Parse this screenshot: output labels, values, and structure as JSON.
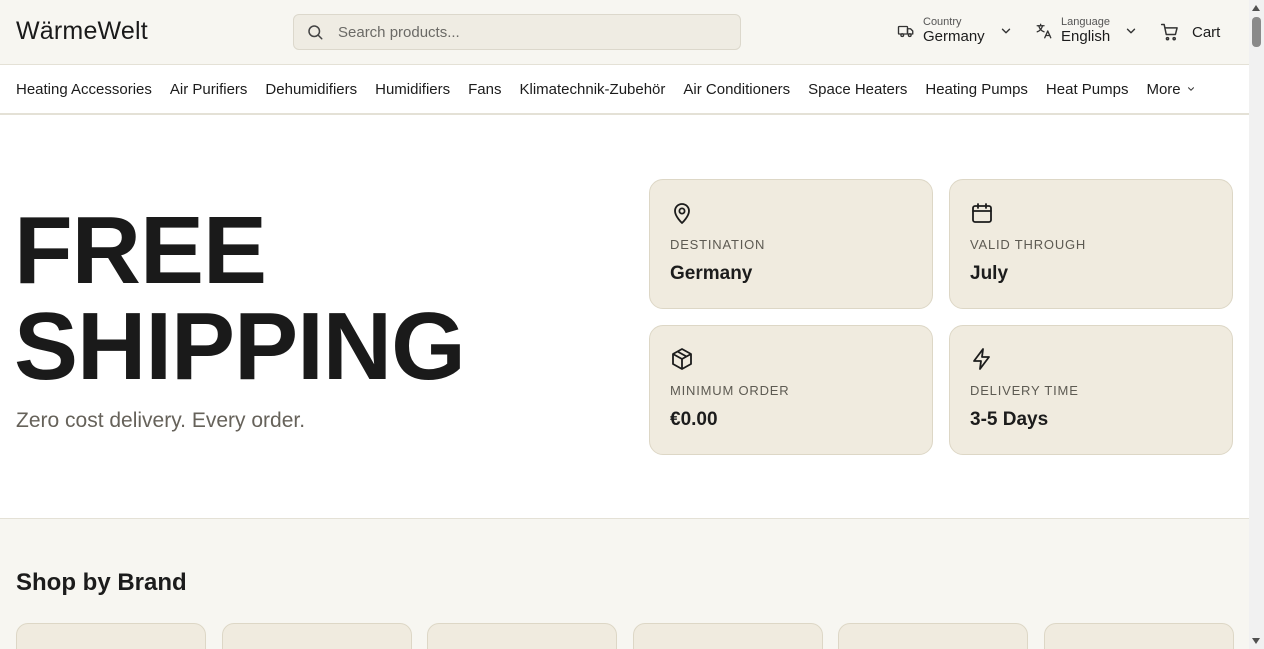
{
  "header": {
    "logo": "WärmeWelt",
    "search_placeholder": "Search products...",
    "country_label": "Country",
    "country_value": "Germany",
    "language_label": "Language",
    "language_value": "English",
    "cart_label": "Cart"
  },
  "nav": {
    "items": [
      "Heating Accessories",
      "Air Purifiers",
      "Dehumidifiers",
      "Humidifiers",
      "Fans",
      "Klimatechnik-Zubehör",
      "Air Conditioners",
      "Space Heaters",
      "Heating Pumps",
      "Heat Pumps"
    ],
    "more_label": "More"
  },
  "hero": {
    "title_line1": "FREE",
    "title_line2": "SHIPPING",
    "subtitle": "Zero cost delivery. Every order.",
    "cards": [
      {
        "icon": "map-pin-icon",
        "label": "DESTINATION",
        "value": "Germany"
      },
      {
        "icon": "calendar-icon",
        "label": "VALID THROUGH",
        "value": "July"
      },
      {
        "icon": "package-icon",
        "label": "MINIMUM ORDER",
        "value": "€0.00"
      },
      {
        "icon": "lightning-icon",
        "label": "DELIVERY TIME",
        "value": "3-5 Days"
      }
    ]
  },
  "brands": {
    "heading": "Shop by Brand"
  }
}
